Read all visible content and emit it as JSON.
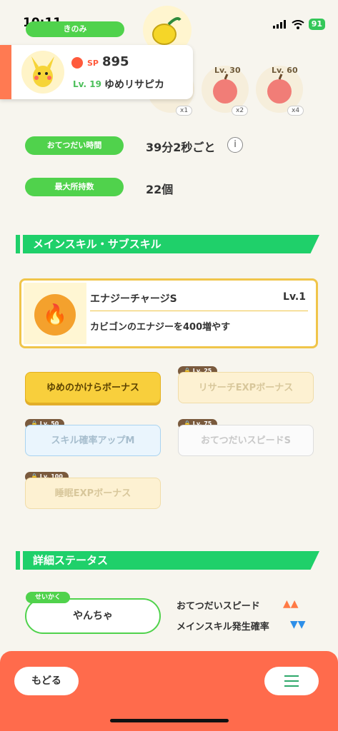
{
  "status_bar": {
    "time": "10:11",
    "battery": "91"
  },
  "berry": {
    "header_label": "きのみ"
  },
  "pokemon": {
    "sp_label": "SP",
    "sp_value": "895",
    "level": "Lv. 19",
    "name": "ゆめリサピカ"
  },
  "ingredients": [
    {
      "unlock_level": "Lv. 30",
      "qty": "x2"
    },
    {
      "unlock_level": "Lv. 60",
      "qty": "x4"
    }
  ],
  "first_ingredient_qty": "x1",
  "stats": {
    "help_time_label": "おてつだい時間",
    "help_time_value": "39分2秒ごと",
    "max_carry_label": "最大所持数",
    "max_carry_value": "22個"
  },
  "skills_section": {
    "title": "メインスキル・サブスキル",
    "main_skill_name": "エナジーチャージS",
    "main_skill_level": "Lv.1",
    "main_skill_description": "カビゴンのエナジーを400増やす",
    "sub_skills": [
      {
        "label": "ゆめのかけらボーナス",
        "lock": ""
      },
      {
        "label": "リサーチEXPボーナス",
        "lock": "Lv. 25"
      },
      {
        "label": "スキル確率アップM",
        "lock": "Lv. 50"
      },
      {
        "label": "おてつだいスピードS",
        "lock": "Lv. 75"
      },
      {
        "label": "睡眠EXPボーナス",
        "lock": "Lv. 100"
      }
    ]
  },
  "details_section": {
    "title": "詳細ステータス",
    "nature_tag": "せいかく",
    "nature_value": "やんちゃ",
    "effect_up_label": "おてつだいスピード",
    "effect_up_arrows": "▲▲",
    "effect_down_label": "メインスキル発生確率",
    "effect_down_arrows": "▼▼"
  },
  "bottom": {
    "back_label": "もどる"
  },
  "colors": {
    "accent_green": "#50d24c",
    "accent_orange": "#ff6b4c",
    "skill_gold": "#f0c54a"
  }
}
